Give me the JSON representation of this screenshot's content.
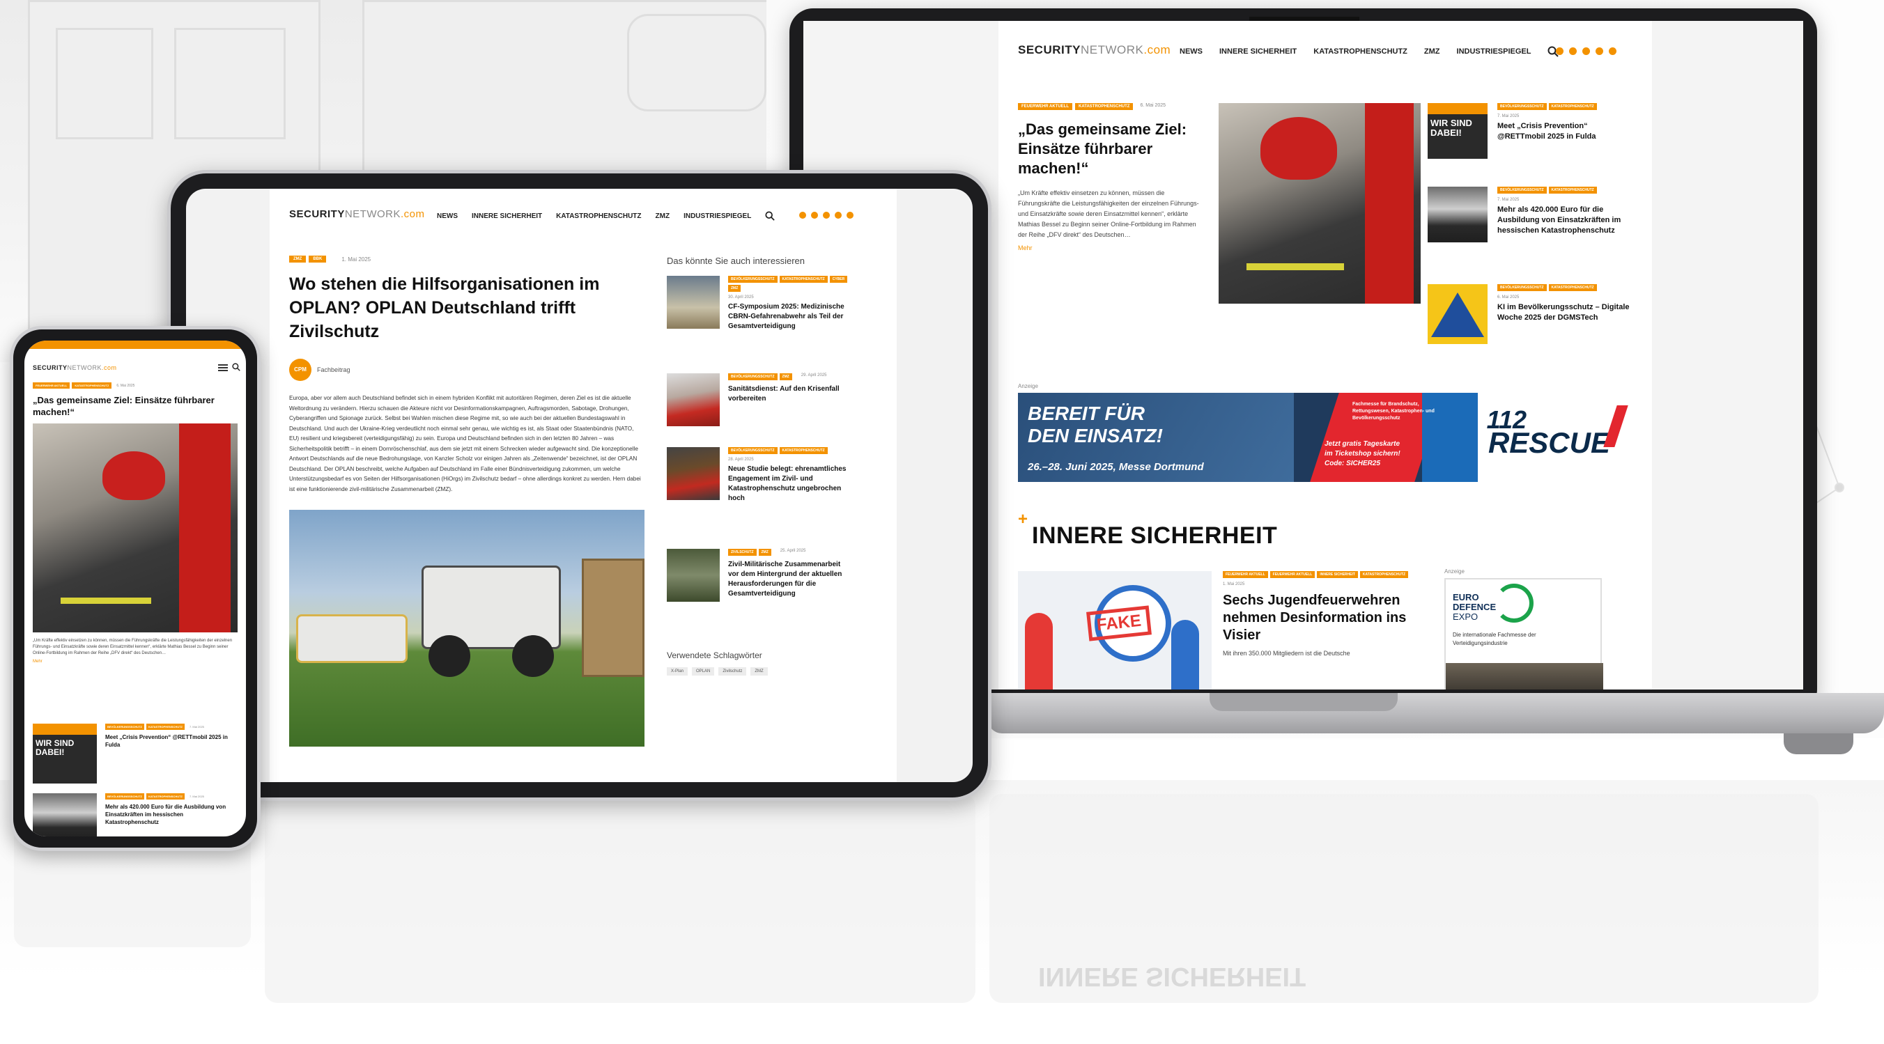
{
  "brand": {
    "logo_part1": "SECURITY",
    "logo_part2": "NETWORK",
    "logo_part3": ".com",
    "accent_color": "#f39200"
  },
  "nav": {
    "items": [
      "NEWS",
      "INNERE SICHERHEIT",
      "KATASTROPHENSCHUTZ",
      "ZMZ",
      "INDUSTRIESPIEGEL"
    ],
    "search_icon": "search-icon",
    "social_icons": [
      "linkedin-icon",
      "facebook-icon",
      "instagram-icon",
      "xing-icon",
      "rss-icon"
    ]
  },
  "laptop": {
    "lead": {
      "tags": [
        "FEUERWEHR AKTUELL",
        "KATASTROPHENSCHUTZ"
      ],
      "date": "6. Mai 2025",
      "title": "„Das gemeinsame Ziel: Einsätze führbarer machen!“",
      "excerpt": "„Um Kräfte effektiv einsetzen zu können, müssen die Führungskräfte die Leistungsfähigkeiten der einzelnen Führungs- und Einsatzkräfte sowie deren Einsatzmittel kennen“, erklärte Mathias Bessel zu Beginn seiner Online-Fortbildung im Rahmen der Reihe „DFV direkt“ des Deutschen…",
      "more": "Mehr"
    },
    "side_articles": [
      {
        "tags": [
          "BEVÖLKERUNGSSCHUTZ",
          "KATASTROPHENSCHUTZ"
        ],
        "date": "7. Mai 2025",
        "title": "Meet „Crisis Prevention“ @RETTmobil 2025 in Fulda",
        "image_caption": "WIR SIND DABEI!"
      },
      {
        "tags": [
          "BEVÖLKERUNGSSCHUTZ",
          "KATASTROPHENSCHUTZ"
        ],
        "date": "7. Mai 2025",
        "title": "Mehr als 420.000 Euro für die Ausbildung von Einsatzkräften im hessischen Katastrophenschutz"
      },
      {
        "tags": [
          "BEVÖLKERUNGSSCHUTZ",
          "KATASTROPHENSCHUTZ"
        ],
        "date": "6. Mai 2025",
        "title": "KI im Bevölkerungsschutz – Digitale Woche 2025 der DGMSTech"
      }
    ],
    "ad": {
      "label": "Anzeige",
      "headline1": "BEREIT FÜR",
      "headline2": "DEN EINSATZ!",
      "dates": "26.–28. Juni 2025, Messe Dortmund",
      "subline": "Fachmesse für Brandschutz, Rettungswesen, Katastrophen- und Bevölkerungsschutz",
      "ticket_line1": "Jetzt gratis Tageskarte",
      "ticket_line2": "im Ticketshop sichern!",
      "ticket_code": "Code: SICHER25",
      "brand_number": "112",
      "brand_name": "RESCUE"
    },
    "section": {
      "title": "INNERE SICHERHEIT",
      "article": {
        "tags": [
          "FEUERWEHR AKTUELL",
          "FEUERWEHR AKTUELL",
          "INNERE SICHERHEIT",
          "KATASTROPHENSCHUTZ"
        ],
        "date": "1. Mai 2025",
        "title": "Sechs Jugendfeuerwehren nehmen Desinformation ins Visier",
        "excerpt": "Mit ihren 350.000 Mitgliedern ist die Deutsche",
        "image_stamp": "FAKE"
      },
      "side_ad": {
        "label": "Anzeige",
        "line1": "EURO",
        "line2": "DEFENCE",
        "line3": "EXPO",
        "tagline": "Die internationale Fachmesse der Verteidigungsindustrie"
      }
    }
  },
  "tablet": {
    "article": {
      "tags": [
        "ZMZ",
        "BBK"
      ],
      "date": "1. Mai 2025",
      "title": "Wo stehen die Hilfsorganisationen im OPLAN? OPLAN Deutschland trifft Zivilschutz",
      "author_badge": "CPM",
      "author": "Fachbeitrag",
      "body": "Europa, aber vor allem auch Deutschland befindet sich in einem hybriden Konflikt mit autoritären Regimen, deren Ziel es ist die aktuelle Weltordnung zu verändern. Hierzu schauen die Akteure nicht vor Desinformationskampagnen, Auftragsmorden, Sabotage, Drohungen, Cyberangriffen und Spionage zurück. Selbst bei Wahlen mischen diese Regime mit, so wie auch bei der aktuellen Bundestagswahl in Deutschland. Und auch der Ukraine-Krieg verdeutlicht noch einmal sehr genau, wie wichtig es ist, als Staat oder Staatenbündnis (NATO, EU) resilient und kriegsbereit (verteidigungsfähig) zu sein. Europa und Deutschland befinden sich in den letzten 80 Jahren – was Sicherheitspolitik betrifft – in einem Dornröschenschlaf, aus dem sie jetzt mit einem Schrecken wieder aufgewacht sind. Die konzeptionelle Antwort Deutschlands auf die neue Bedrohungslage, von Kanzler Scholz vor einigen Jahren als „Zeitenwende“ bezeichnet, ist der OPLAN Deutschland. Der OPLAN beschreibt, welche Aufgaben auf Deutschland im Falle einer Bündnisverteidigung zukommen, um welche Unterstützungsbedarf es von Seiten der Hilfsorganisationen (HiOrgs) im Zivilschutz bedarf – ohne allerdings konkret zu werden. Hern dabei ist eine funktionierende zivil-militärische Zusammenarbeit (ZMZ)."
    },
    "sidebar": {
      "title": "Das könnte Sie auch interessieren",
      "items": [
        {
          "tags": [
            "BEVÖLKERUNGSSCHUTZ",
            "KATASTROPHENSCHUTZ",
            "CYBER",
            "ZMZ"
          ],
          "date": "30. April 2025",
          "title": "CF-Symposium 2025: Medizinische CBRN-Gefahrenabwehr als Teil der Gesamtverteidigung"
        },
        {
          "tags": [
            "BEVÖLKERUNGSSCHUTZ",
            "ZMZ"
          ],
          "date": "29. April 2025",
          "title": "Sanitätsdienst: Auf den Krisenfall vorbereiten"
        },
        {
          "tags": [
            "BEVÖLKERUNGSSCHUTZ",
            "KATASTROPHENSCHUTZ"
          ],
          "date": "28. April 2025",
          "title": "Neue Studie belegt: ehrenamtliches Engagement im Zivil- und Katastrophenschutz ungebrochen hoch"
        },
        {
          "tags": [
            "ZIVILSCHUTZ",
            "ZMZ"
          ],
          "date": "25. April 2025",
          "title": "Zivil-Militärische Zusammenarbeit vor dem Hintergrund der aktuellen Herausforderungen für die Gesamtverteidigung"
        }
      ],
      "keywords_title": "Verwendete Schlagwörter",
      "keywords": [
        "X-Plan",
        "OPLAN",
        "Zivilschutz",
        "ZMZ"
      ]
    }
  },
  "phone": {
    "lead": {
      "tags": [
        "FEUERWEHR AKTUELL",
        "KATASTROPHENSCHUTZ"
      ],
      "date": "6. Mai 2025",
      "title": "„Das gemeinsame Ziel: Einsätze führbarer machen!“",
      "excerpt": "„Um Kräfte effektiv einsetzen zu können, müssen die Führungskräfte die Leistungsfähigkeiten der einzelnen Führungs- und Einsatzkräfte sowie deren Einsatzmittel kennen“, erklärte Mathias Bessel zu Beginn seiner Online-Fortbildung im Rahmen der Reihe „DFV direkt“ des Deutschen…",
      "more": "Mehr"
    },
    "items": [
      {
        "tags": [
          "BEVÖLKERUNGSSCHUTZ",
          "KATASTROPHENSCHUTZ"
        ],
        "date": "7. Mai 2025",
        "title": "Meet „Crisis Prevention“ @RETTmobil 2025 in Fulda",
        "image_caption": "WIR SIND DABEI!"
      },
      {
        "tags": [
          "BEVÖLKERUNGSSCHUTZ",
          "KATASTROPHENSCHUTZ"
        ],
        "date": "7. Mai 2025",
        "title": "Mehr als 420.000 Euro für die Ausbildung von Einsatzkräften im hessischen Katastrophenschutz"
      }
    ]
  },
  "reflection_text": "INNERE SICHERHEIT"
}
